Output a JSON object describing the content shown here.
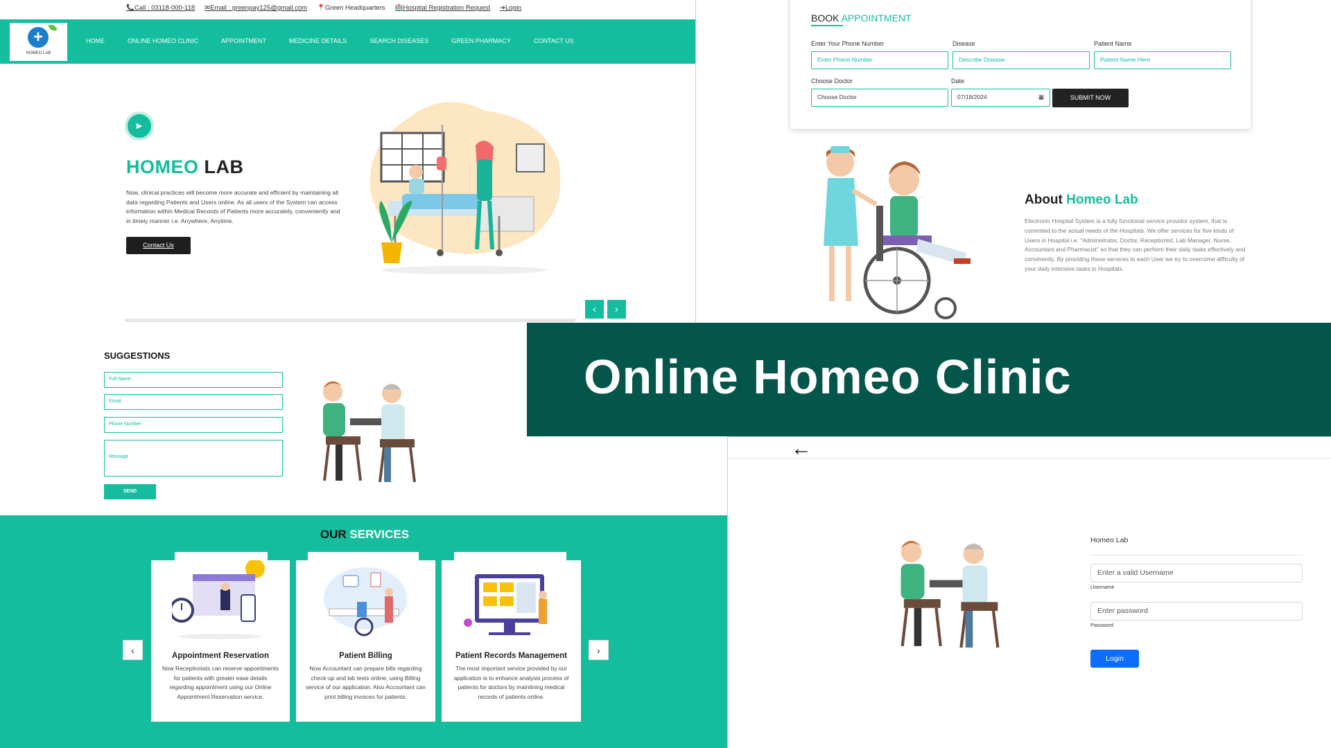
{
  "colors": {
    "accent": "#13bd9d",
    "banner_bg": "#05564a",
    "login_button": "#0d6efd",
    "dark_button": "#1e1e1e"
  },
  "landing": {
    "topbar": {
      "call": "📞Call : 03118-000-118",
      "email": "✉Email : greenpay125@gmail.com",
      "location": "📍Green Headquarters",
      "registration": "🏥Hospital Registration Request",
      "login": "➔Login"
    },
    "logo_text": "HOMEO LAB",
    "nav": [
      "HOME",
      "ONLINE HOMEO CLINIC",
      "APPOINTMENT",
      "MEDICINE DETAILS",
      "SEARCH DISEASES",
      "GREEN PHARMACY",
      "CONTACT US"
    ],
    "hero": {
      "title_part1": "HOMEO",
      "title_part2": " LAB",
      "description": "Now, clinical practices will become more accurate and efficient by maintaining all data regarding Patients and Users online. As all users of the System can access information within Medical Records of Patients more accurately, conveniently and in timely manner i.e. Anywhere, Anytime.",
      "button": "Contact Us",
      "prev_arrow": "‹",
      "next_arrow": "›"
    }
  },
  "appointment": {
    "title_part1": "BOOK ",
    "title_part2": "APPOINTMENT",
    "phone_label": "Enter Your Phone Number",
    "phone_placeholder": "Enter Phone Number",
    "disease_label": "Disease",
    "disease_placeholder": "Describe Disease",
    "patient_label": "Patient Name",
    "patient_placeholder": "Patient Name Here",
    "doctor_label": "Choose Doctor",
    "doctor_value": "Choose Doctor",
    "date_label": "Date",
    "date_value": "07/18/2024",
    "submit": "SUBMIT NOW"
  },
  "about": {
    "title_part1": "About ",
    "title_part2": "Homeo Lab",
    "text": "Electronic Hospital System is a fully funcitonal service providor system, that is commited to the actual needs of the Hospitals. We offer services for five kinds of Users in Hospital i.e. \"Administrator, Doctor, Receptionist, Lab Manager, Nurse, Accountant and Pharmacist\" so that they can perform their daily tasks effectively and convinently. By providing these services to each User we try to overcome difficulty of your daily intensive tasks in Hospitals."
  },
  "suggestions": {
    "title": "SUGGESTIONS",
    "full_name": "Full Name",
    "email": "Email",
    "phone": "Phone Number",
    "message": "Message",
    "send": "SEND"
  },
  "banner": {
    "title": "Online Homeo Clinic"
  },
  "services": {
    "title_part1": "OUR ",
    "title_part2": "SERVICES",
    "prev_arrow": "‹",
    "next_arrow": "›",
    "items": [
      {
        "name": "Appointment Reservation",
        "desc": "Now Receptionists can reserve appointments for patients with greater ease details regarding appointment using our Online Appointment Reservation service."
      },
      {
        "name": "Patient Billing",
        "desc": "Now Accountant can prepare bills regarding check-up and lab tests online, using Billing service of our application. Also Accountant can print billing invoices for patients."
      },
      {
        "name": "Patient Records Management",
        "desc": "The most important service provided by our application is to enhance analysis process of patients for doctors by maintining medical records of patients online."
      }
    ]
  },
  "login": {
    "back": "←",
    "heading": "Homeo Lab",
    "username_placeholder": "Enter a valid Username",
    "username_label": "Username",
    "password_placeholder": "Enter password",
    "password_label": "Password",
    "button": "Login"
  }
}
